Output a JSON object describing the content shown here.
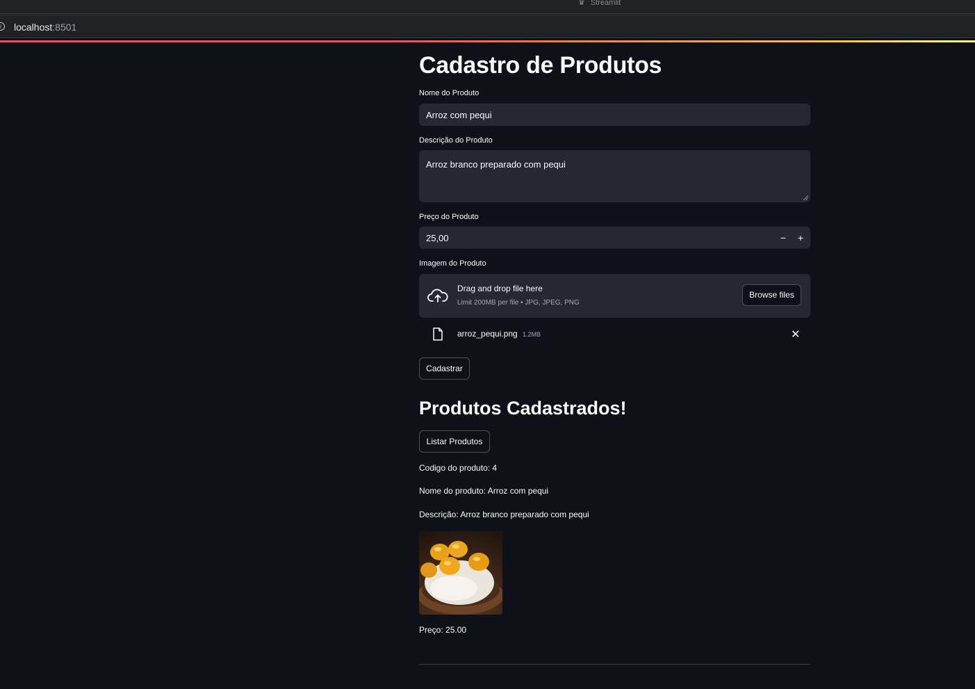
{
  "browser": {
    "window_title": "Streamlit",
    "url_host": "localhost",
    "url_port": ":8501"
  },
  "form": {
    "title": "Cadastro de Produtos",
    "name_label": "Nome do Produto",
    "name_value": "Arroz com pequi",
    "description_label": "Descrição do Produto",
    "description_value": "Arroz branco preparado com pequi",
    "price_label": "Preço do Produto",
    "price_value": "25,00",
    "decrement_label": "−",
    "increment_label": "+",
    "image_label": "Imagem do Produto",
    "dropzone_text": "Drag and drop file here",
    "dropzone_limit": "Limit 200MB per file • JPG, JPEG, PNG",
    "browse_button": "Browse files",
    "uploaded_file_name": "arroz_pequi.png",
    "uploaded_file_size": "1.2MB",
    "submit_button": "Cadastrar"
  },
  "listing": {
    "title": "Produtos Cadastrados!",
    "list_button": "Listar Produtos",
    "product_code": "Codigo do produto: 4",
    "product_name": "Nome do produto: Arroz com pequi",
    "product_description": "Descrição: Arroz branco preparado com pequi",
    "product_price": "Preço: 25.00"
  },
  "colors": {
    "background": "#0e1117",
    "input_background": "#262730",
    "accent": "#ff4b4b"
  }
}
